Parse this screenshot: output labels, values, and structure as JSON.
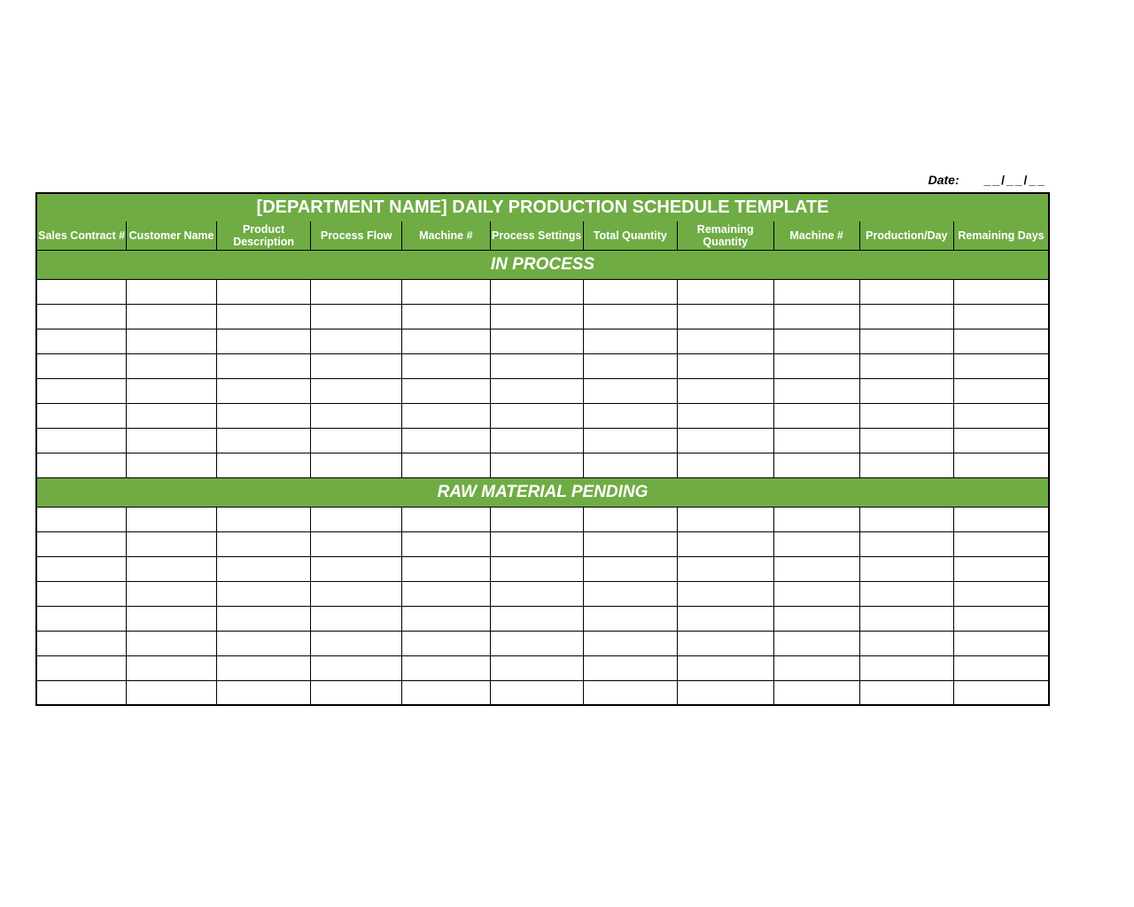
{
  "date": {
    "label": "Date:",
    "value": "__/__/__"
  },
  "title": "[DEPARTMENT NAME] DAILY PRODUCTION SCHEDULE TEMPLATE",
  "columns": [
    "Sales Contract #",
    "Customer Name",
    "Product Description",
    "Process Flow",
    "Machine #",
    "Process Settings",
    "Total Quantity",
    "Remaining Quantity",
    "Machine #",
    "Production/Day",
    "Remaining Days"
  ],
  "sections": [
    {
      "label": "IN PROCESS",
      "row_count": 8
    },
    {
      "label": "RAW MATERIAL PENDING",
      "row_count": 8
    }
  ],
  "colors": {
    "accent": "#6fac44"
  }
}
